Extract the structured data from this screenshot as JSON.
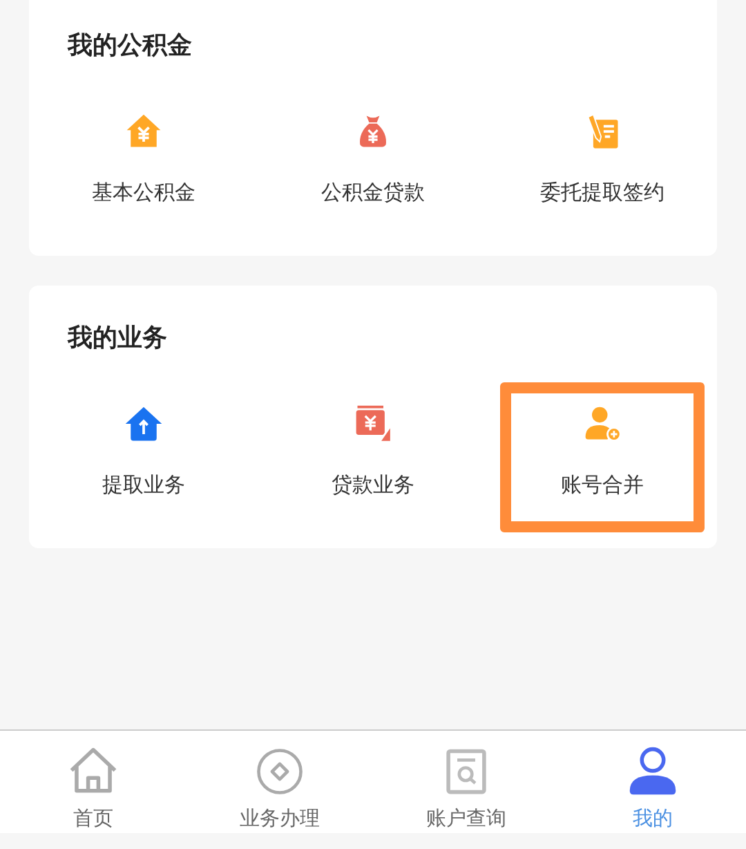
{
  "sections": [
    {
      "title": "我的公积金",
      "items": [
        {
          "label": "基本公积金",
          "highlighted": false
        },
        {
          "label": "公积金贷款",
          "highlighted": false
        },
        {
          "label": "委托提取签约",
          "highlighted": false
        }
      ]
    },
    {
      "title": "我的业务",
      "items": [
        {
          "label": "提取业务",
          "highlighted": false
        },
        {
          "label": "贷款业务",
          "highlighted": false
        },
        {
          "label": "账号合并",
          "highlighted": true
        }
      ]
    }
  ],
  "tab_bar": [
    {
      "label": "首页",
      "selected": false
    },
    {
      "label": "业务办理",
      "selected": false
    },
    {
      "label": "账户查询",
      "selected": false
    },
    {
      "label": "我的",
      "selected": true
    }
  ]
}
